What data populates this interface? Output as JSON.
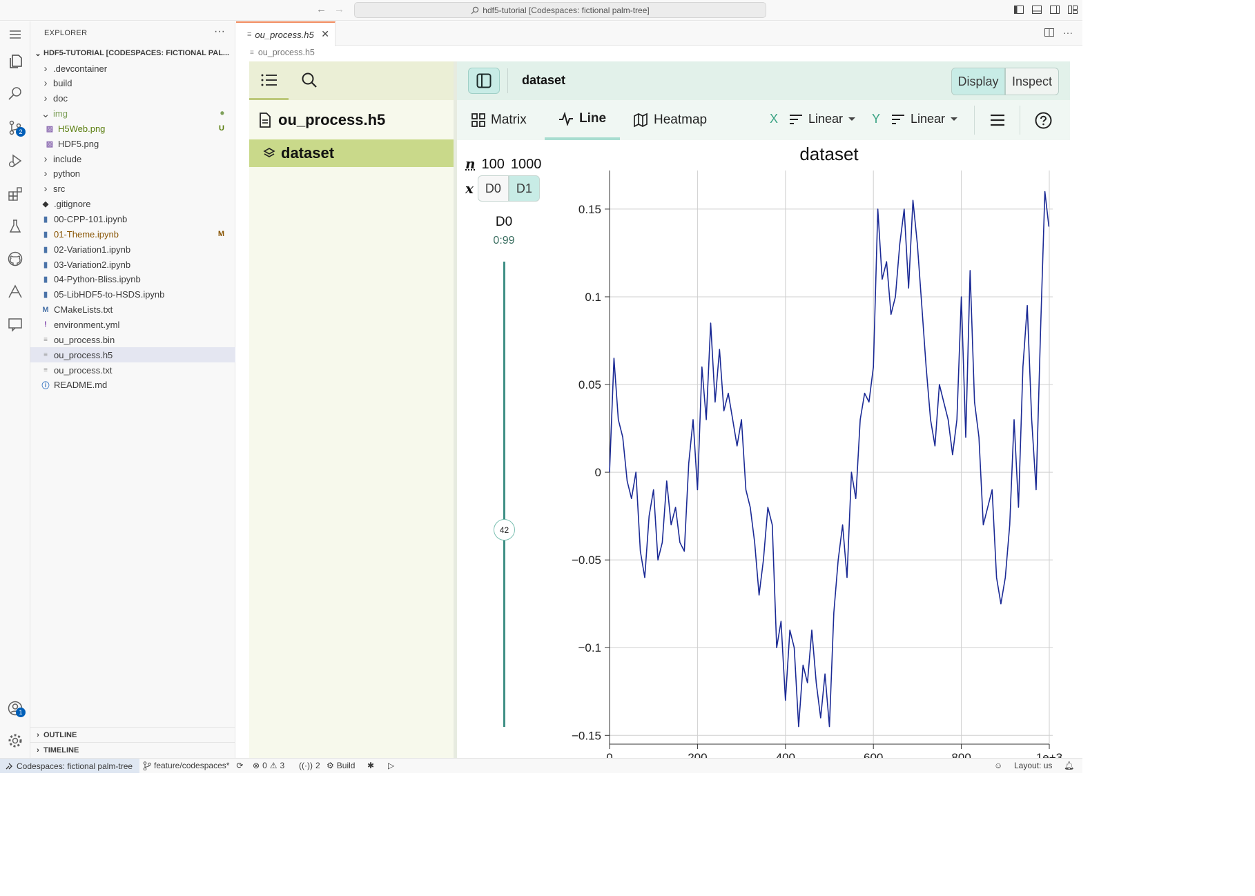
{
  "titlebar": {
    "command_center": "hdf5-tutorial [Codespaces: fictional palm-tree]"
  },
  "activity": {
    "scm_badge": "2",
    "account_badge": "1"
  },
  "sidebar": {
    "title": "EXPLORER",
    "root": "HDF5-TUTORIAL [CODESPACES: FICTIONAL PAL...",
    "items": [
      {
        "label": ".devcontainer",
        "kind": "folder",
        "deco": ""
      },
      {
        "label": "build",
        "kind": "folder",
        "deco": ""
      },
      {
        "label": "doc",
        "kind": "folder",
        "deco": ""
      },
      {
        "label": "img",
        "kind": "folder-open",
        "deco": "•"
      },
      {
        "label": "H5Web.png",
        "kind": "image",
        "deco": "U"
      },
      {
        "label": "HDF5.png",
        "kind": "image",
        "deco": ""
      },
      {
        "label": "include",
        "kind": "folder",
        "deco": ""
      },
      {
        "label": "python",
        "kind": "folder",
        "deco": ""
      },
      {
        "label": "src",
        "kind": "folder",
        "deco": ""
      },
      {
        "label": ".gitignore",
        "kind": "git",
        "deco": ""
      },
      {
        "label": "00-CPP-101.ipynb",
        "kind": "notebook",
        "deco": ""
      },
      {
        "label": "01-Theme.ipynb",
        "kind": "notebook",
        "deco": "M"
      },
      {
        "label": "02-Variation1.ipynb",
        "kind": "notebook",
        "deco": ""
      },
      {
        "label": "03-Variation2.ipynb",
        "kind": "notebook",
        "deco": ""
      },
      {
        "label": "04-Python-Bliss.ipynb",
        "kind": "notebook",
        "deco": ""
      },
      {
        "label": "05-LibHDF5-to-HSDS.ipynb",
        "kind": "notebook",
        "deco": ""
      },
      {
        "label": "CMakeLists.txt",
        "kind": "cmake",
        "deco": ""
      },
      {
        "label": "environment.yml",
        "kind": "yaml",
        "deco": ""
      },
      {
        "label": "ou_process.bin",
        "kind": "text",
        "deco": ""
      },
      {
        "label": "ou_process.h5",
        "kind": "text",
        "deco": ""
      },
      {
        "label": "ou_process.txt",
        "kind": "text",
        "deco": ""
      },
      {
        "label": "README.md",
        "kind": "info",
        "deco": ""
      }
    ],
    "outline": "OUTLINE",
    "timeline": "TIMELINE"
  },
  "editor": {
    "tab_label": "ou_process.h5",
    "breadcrumb": "ou_process.h5"
  },
  "h5web": {
    "file_name": "ou_process.h5",
    "dataset_name": "dataset",
    "header_title": "dataset",
    "display_label": "Display",
    "inspect_label": "Inspect",
    "vis_tabs": [
      "Matrix",
      "Line",
      "Heatmap"
    ],
    "x_axis_letter": "X",
    "x_scale": "Linear",
    "y_axis_letter": "Y",
    "y_scale": "Linear",
    "dims": {
      "n_label": "n",
      "n_values": [
        "100",
        "1000"
      ],
      "x_label": "x",
      "d0": "D0",
      "d1": "D1",
      "slider_name": "D0",
      "slider_range": "0:99",
      "slider_value": "42",
      "slider_fraction": 0.424
    }
  },
  "colors": {
    "line": "#1b2a95",
    "accent": "#3aa383"
  },
  "chart_data": {
    "type": "line",
    "title": "dataset",
    "xlabel": "",
    "ylabel": "",
    "xlim": [
      0,
      1000
    ],
    "ylim": [
      -0.155,
      0.172
    ],
    "x_ticks": [
      "0",
      "200",
      "400",
      "600",
      "800",
      "1e+3"
    ],
    "x_tick_values": [
      0,
      200,
      400,
      600,
      800,
      1000
    ],
    "y_ticks": [
      "0.15",
      "0.1",
      "0.05",
      "0",
      "−0.05",
      "−0.1",
      "−0.15"
    ],
    "y_tick_values": [
      0.15,
      0.1,
      0.05,
      0,
      -0.05,
      -0.1,
      -0.15
    ],
    "grid": true,
    "x": [
      0,
      10,
      20,
      30,
      40,
      50,
      60,
      70,
      80,
      90,
      100,
      110,
      120,
      130,
      140,
      150,
      160,
      170,
      180,
      190,
      200,
      210,
      220,
      230,
      240,
      250,
      260,
      270,
      280,
      290,
      300,
      310,
      320,
      330,
      340,
      350,
      360,
      370,
      380,
      390,
      400,
      410,
      420,
      430,
      440,
      450,
      460,
      470,
      480,
      490,
      500,
      510,
      520,
      530,
      540,
      550,
      560,
      570,
      580,
      590,
      600,
      610,
      620,
      630,
      640,
      650,
      660,
      670,
      680,
      690,
      700,
      710,
      720,
      730,
      740,
      750,
      760,
      770,
      780,
      790,
      800,
      810,
      820,
      830,
      840,
      850,
      860,
      870,
      880,
      890,
      900,
      910,
      920,
      930,
      940,
      950,
      960,
      970,
      980,
      990,
      999
    ],
    "values": [
      0.0,
      0.065,
      0.03,
      0.02,
      -0.005,
      -0.015,
      0.0,
      -0.045,
      -0.06,
      -0.025,
      -0.01,
      -0.05,
      -0.04,
      -0.005,
      -0.03,
      -0.02,
      -0.04,
      -0.045,
      0.005,
      0.03,
      -0.01,
      0.06,
      0.03,
      0.085,
      0.04,
      0.07,
      0.035,
      0.045,
      0.03,
      0.015,
      0.03,
      -0.01,
      -0.02,
      -0.04,
      -0.07,
      -0.05,
      -0.02,
      -0.03,
      -0.1,
      -0.085,
      -0.13,
      -0.09,
      -0.1,
      -0.145,
      -0.11,
      -0.12,
      -0.09,
      -0.12,
      -0.14,
      -0.115,
      -0.145,
      -0.08,
      -0.05,
      -0.03,
      -0.06,
      0.0,
      -0.015,
      0.03,
      0.045,
      0.04,
      0.06,
      0.15,
      0.11,
      0.12,
      0.09,
      0.1,
      0.13,
      0.15,
      0.105,
      0.155,
      0.13,
      0.095,
      0.06,
      0.03,
      0.015,
      0.05,
      0.04,
      0.03,
      0.01,
      0.03,
      0.1,
      0.02,
      0.115,
      0.04,
      0.02,
      -0.03,
      -0.02,
      -0.01,
      -0.06,
      -0.075,
      -0.06,
      -0.03,
      0.03,
      -0.02,
      0.06,
      0.095,
      0.03,
      -0.01,
      0.08,
      0.16,
      0.14
    ]
  },
  "statusbar": {
    "remote": "Codespaces: fictional palm-tree",
    "branch": "feature/codespaces*",
    "errors": "0",
    "warnings": "3",
    "ports": "2",
    "build": "Build",
    "layout": "Layout: us"
  }
}
